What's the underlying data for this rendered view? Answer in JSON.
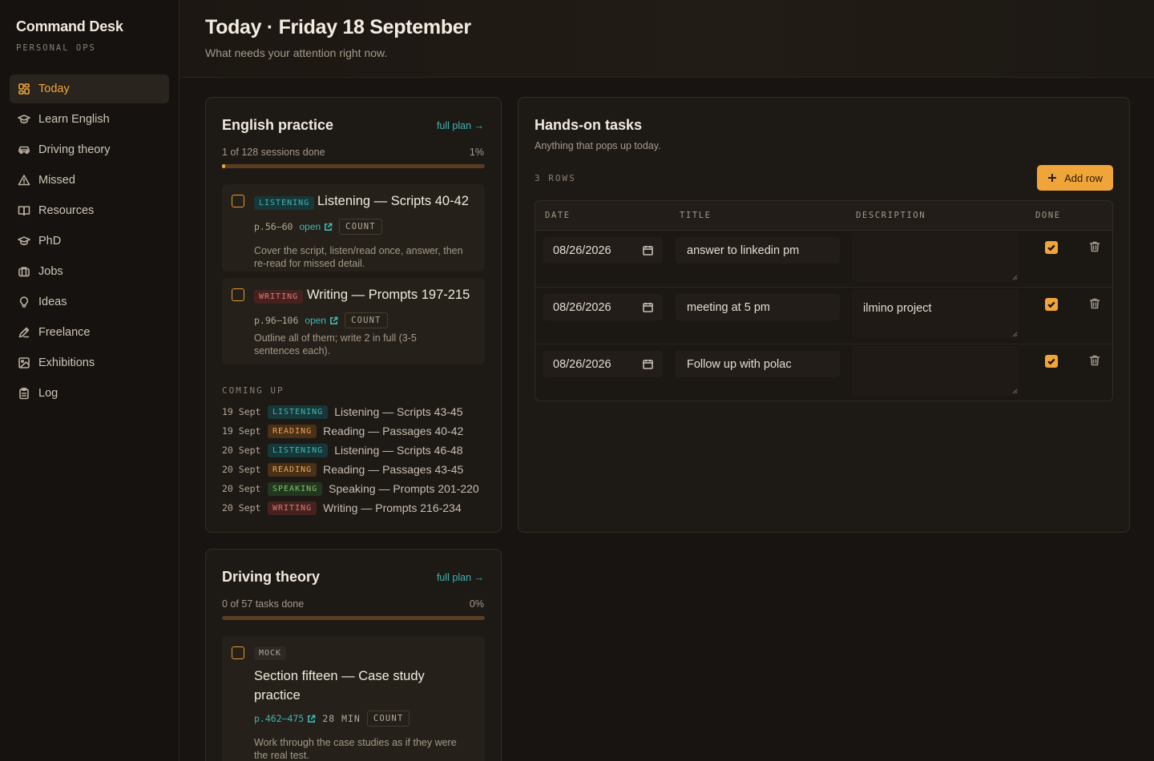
{
  "sidebar": {
    "brand": "Command Desk",
    "subtitle": "PERSONAL OPS",
    "items": [
      {
        "label": "Today",
        "icon": "dashboard-icon",
        "active": true
      },
      {
        "label": "Learn English",
        "icon": "graduation-cap-icon"
      },
      {
        "label": "Driving theory",
        "icon": "car-icon"
      },
      {
        "label": "Missed",
        "icon": "warning-icon"
      },
      {
        "label": "Resources",
        "icon": "book-open-icon"
      },
      {
        "label": "PhD",
        "icon": "graduation-cap-icon"
      },
      {
        "label": "Jobs",
        "icon": "briefcase-icon"
      },
      {
        "label": "Ideas",
        "icon": "lightbulb-icon"
      },
      {
        "label": "Freelance",
        "icon": "pen-icon"
      },
      {
        "label": "Exhibitions",
        "icon": "image-icon"
      },
      {
        "label": "Log",
        "icon": "clipboard-icon"
      }
    ]
  },
  "header": {
    "title": "Today · Friday 18 September",
    "subtitle": "What needs your attention right now."
  },
  "english": {
    "title": "English practice",
    "link": "full plan →",
    "progress_label": "1 of 128 sessions done",
    "progress_pct_label": "1%",
    "progress_fraction": 0.01,
    "sessions": [
      {
        "tag": "LISTENING",
        "title": "Listening — Scripts 40-42",
        "pages": "p.56–60",
        "open": "open",
        "count": "COUNT",
        "desc_line1": "Cover the script, listen/read once, answer, then",
        "desc_line2": "re-read for missed detail."
      },
      {
        "tag": "WRITING",
        "title": "Writing — Prompts 197-215",
        "pages": "p.96–106",
        "open": "open",
        "count": "COUNT",
        "desc_line1": "Outline all of them; write 2 in full (3-5",
        "desc_line2": "sentences each)."
      }
    ],
    "upcoming_heading": "COMING UP",
    "upcoming": [
      {
        "date": "19 Sept",
        "tag": "LISTENING",
        "title": "Listening — Scripts 43-45"
      },
      {
        "date": "19 Sept",
        "tag": "READING",
        "title": "Reading — Passages 40-42"
      },
      {
        "date": "20 Sept",
        "tag": "LISTENING",
        "title": "Listening — Scripts 46-48"
      },
      {
        "date": "20 Sept",
        "tag": "READING",
        "title": "Reading — Passages 43-45"
      },
      {
        "date": "20 Sept",
        "tag": "SPEAKING",
        "title": "Speaking — Prompts 201-220"
      },
      {
        "date": "20 Sept",
        "tag": "WRITING",
        "title": "Writing — Prompts 216-234"
      }
    ]
  },
  "tasks": {
    "title": "Hands-on tasks",
    "subtitle": "Anything that pops up today.",
    "rows_count": "3 ROWS",
    "add_label": "Add row",
    "columns": [
      "DATE",
      "TITLE",
      "DESCRIPTION",
      "DONE"
    ],
    "rows": [
      {
        "date": "08/26/2026",
        "title": "answer to linkedin pm",
        "description": "",
        "done": true
      },
      {
        "date": "08/26/2026",
        "title": "meeting at 5 pm",
        "description": "ilmino project",
        "done": true
      },
      {
        "date": "08/26/2026",
        "title": "Follow up with polac",
        "description": "",
        "done": true
      }
    ]
  },
  "driving": {
    "title": "Driving theory",
    "link": "full plan →",
    "progress_label": "0 of 57 tasks done",
    "progress_pct_label": "0%",
    "progress_fraction": 0.0,
    "task": {
      "tag": "MOCK",
      "title_line1": "Section fifteen — Case study",
      "title_line2": "practice",
      "pages": "p.462–475",
      "duration": "28 MIN",
      "count": "COUNT",
      "desc_line1": "Work through the case studies as if they were",
      "desc_line2": "the real test."
    }
  },
  "colors": {
    "accent": "#f0a53a",
    "link": "#3fb6b0",
    "background": "#171411"
  }
}
